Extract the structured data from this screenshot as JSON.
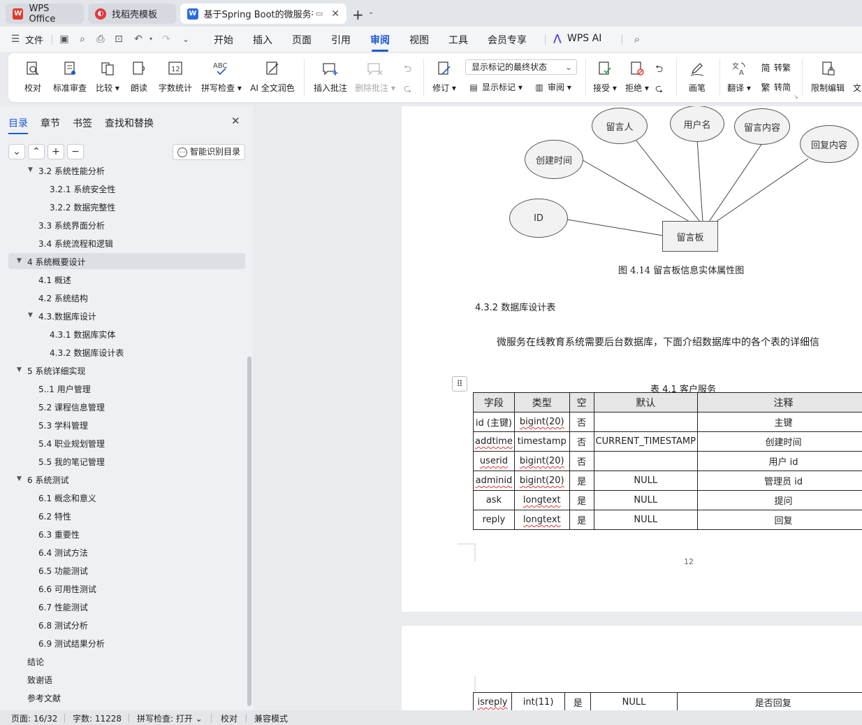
{
  "tabs": [
    {
      "label": "WPS Office"
    },
    {
      "label": "找稻壳模板"
    },
    {
      "label": "基于Spring Boot的微服务在"
    }
  ],
  "menu": {
    "file": "文件",
    "items": [
      "开始",
      "插入",
      "页面",
      "引用",
      "审阅",
      "视图",
      "工具",
      "会员专享"
    ],
    "active": "审阅",
    "wps_ai": "WPS AI"
  },
  "ribbon": {
    "proofread": "校对",
    "std_review": "标准审查",
    "compare": "比较",
    "read_aloud": "朗读",
    "word_count": "字数统计",
    "spell_check": "拼写检查",
    "ai_polish": "AI 全文润色",
    "insert_comment": "插入批注",
    "delete_comment": "删除批注",
    "revise": "修订",
    "markup_select": "显示标记的最终状态",
    "show_markup": "显示标记",
    "review": "审阅",
    "accept": "接受",
    "reject": "拒绝",
    "pen": "画笔",
    "translate": "翻译",
    "to_traditional": "转繁",
    "to_simplified": "转简",
    "restrict_edit": "限制编辑",
    "doc_cut": "文"
  },
  "panel": {
    "tabs": [
      "目录",
      "章节",
      "书签",
      "查找和替换"
    ],
    "smart_toc": "智能识别目录"
  },
  "toc": [
    {
      "text": "3.2 系统性能分析",
      "level": 2,
      "expanded": true
    },
    {
      "text": "3.2.1  系统安全性",
      "level": 3
    },
    {
      "text": "3.2.2  数据完整性",
      "level": 3
    },
    {
      "text": "3.3 系统界面分析",
      "level": 2
    },
    {
      "text": "3.4 系统流程和逻辑",
      "level": 2
    },
    {
      "text": "4 系统概要设计",
      "level": 1,
      "expanded": true,
      "selected": true
    },
    {
      "text": "4.1 概述",
      "level": 2
    },
    {
      "text": "4.2 系统结构",
      "level": 2
    },
    {
      "text": "4.3.数据库设计",
      "level": 2,
      "expanded": true
    },
    {
      "text": "4.3.1 数据库实体",
      "level": 3
    },
    {
      "text": "4.3.2 数据库设计表",
      "level": 3
    },
    {
      "text": "5 系统详细实现",
      "level": 1,
      "expanded": true
    },
    {
      "text": "5..1  用户管理",
      "level": 2
    },
    {
      "text": "5.2  课程信息管理",
      "level": 2
    },
    {
      "text": "5.3  学科管理",
      "level": 2
    },
    {
      "text": "5.4  职业规划管理",
      "level": 2
    },
    {
      "text": "5.5  我的笔记管理",
      "level": 2
    },
    {
      "text": "6 系统测试",
      "level": 1,
      "expanded": true
    },
    {
      "text": "6.1 概念和意义",
      "level": 2
    },
    {
      "text": "6.2 特性",
      "level": 2
    },
    {
      "text": "6.3 重要性",
      "level": 2
    },
    {
      "text": "6.4 测试方法",
      "level": 2
    },
    {
      "text": "6.5  功能测试",
      "level": 2
    },
    {
      "text": "6.6 可用性测试",
      "level": 2
    },
    {
      "text": "6.7 性能测试",
      "level": 2
    },
    {
      "text": "6.8 测试分析",
      "level": 2
    },
    {
      "text": "6.9 测试结果分析",
      "level": 2
    },
    {
      "text": "结论",
      "level": 1
    },
    {
      "text": "致谢语",
      "level": 1
    },
    {
      "text": "参考文献",
      "level": 1
    }
  ],
  "diagram": {
    "entity": "留言板",
    "attributes": [
      "留言人",
      "用户名",
      "留言内容",
      "回复内容",
      "创建时间",
      "ID"
    ],
    "caption": "图 4.14 留言板信息实体属性图"
  },
  "doc": {
    "section_heading": "4.3.2 数据库设计表",
    "paragraph": "微服务在线教育系统需要后台数据库，下面介绍数据库中的各个表的详细信",
    "table_caption": "表 4.1  客户服务",
    "page_number": "12"
  },
  "table": {
    "headers": [
      "字段",
      "类型",
      "空",
      "默认",
      "注释"
    ],
    "rows": [
      [
        "id (主键)",
        "bigint(20)",
        "否",
        "",
        "主键"
      ],
      [
        "addtime",
        "timestamp",
        "否",
        "CURRENT_TIMESTAMP",
        "创建时间"
      ],
      [
        "userid",
        "bigint(20)",
        "否",
        "",
        "用户 id"
      ],
      [
        "adminid",
        "bigint(20)",
        "是",
        "NULL",
        "管理员 id"
      ],
      [
        "ask",
        "longtext",
        "是",
        "NULL",
        "提问"
      ],
      [
        "reply",
        "longtext",
        "是",
        "NULL",
        "回复"
      ]
    ],
    "continued_row": [
      "isreply",
      "int(11)",
      "是",
      "NULL",
      "是否回复"
    ]
  },
  "status": {
    "page": "页面: 16/32",
    "words": "字数: 11228",
    "spell": "拼写检查: 打开",
    "proof": "校对",
    "compat": "兼容模式"
  },
  "colors": {
    "accent": "#1c5ad6",
    "wps_red": "#e33b2e",
    "docer_red": "#e0383e",
    "word_blue": "#2b6cdf"
  }
}
